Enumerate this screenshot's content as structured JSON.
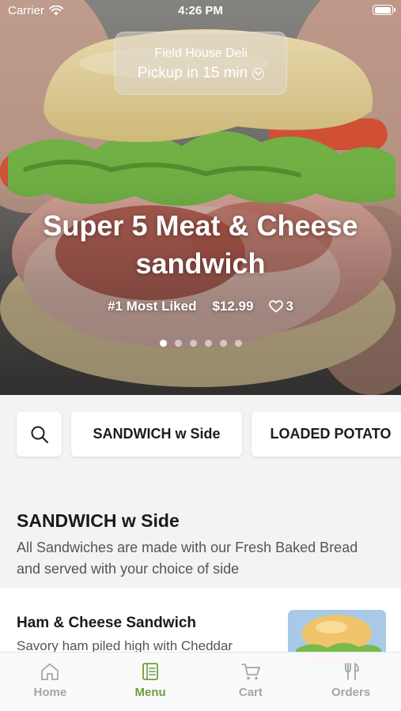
{
  "status_bar": {
    "carrier": "Carrier",
    "time": "4:26 PM",
    "battery_level": 1.0
  },
  "store": {
    "name": "Field House Deli",
    "pickup": "Pickup in 15 min"
  },
  "hero": {
    "title": "Super 5 Meat & Cheese sandwich",
    "badge": "#1 Most Liked",
    "price": "$12.99",
    "likes": "3",
    "slide_count": 6,
    "active_slide": 0
  },
  "categories": [
    {
      "label": "SANDWICH w Side"
    },
    {
      "label": "LOADED POTATO"
    }
  ],
  "section": {
    "title": "SANDWICH w Side",
    "description": "All Sandwiches are made with our Fresh Baked Bread and served with your choice of side"
  },
  "items": [
    {
      "name": "Ham & Cheese Sandwich",
      "description": "Savory ham piled high with Cheddar"
    }
  ],
  "tabs": [
    {
      "label": "Home",
      "icon": "home-icon",
      "active": false
    },
    {
      "label": "Menu",
      "icon": "menu-book-icon",
      "active": true
    },
    {
      "label": "Cart",
      "icon": "cart-icon",
      "active": false
    },
    {
      "label": "Orders",
      "icon": "utensils-icon",
      "active": false
    }
  ],
  "colors": {
    "accent": "#6d9e3b",
    "tab_inactive": "#a5a5a5",
    "background_gray": "#f3f3f3"
  }
}
